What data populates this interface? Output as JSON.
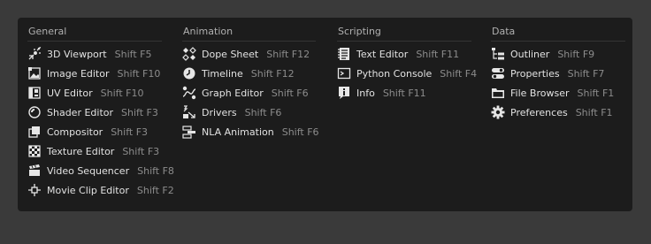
{
  "menu": {
    "columns": [
      {
        "header": "General",
        "items": [
          {
            "label": "3D Viewport",
            "shortcut": "Shift F5",
            "icon": "3d-viewport-icon"
          },
          {
            "label": "Image Editor",
            "shortcut": "Shift F10",
            "icon": "image-editor-icon"
          },
          {
            "label": "UV Editor",
            "shortcut": "Shift F10",
            "icon": "uv-editor-icon"
          },
          {
            "label": "Shader Editor",
            "shortcut": "Shift F3",
            "icon": "shader-editor-icon"
          },
          {
            "label": "Compositor",
            "shortcut": "Shift F3",
            "icon": "compositor-icon"
          },
          {
            "label": "Texture Editor",
            "shortcut": "Shift F3",
            "icon": "texture-editor-icon"
          },
          {
            "label": "Video Sequencer",
            "shortcut": "Shift F8",
            "icon": "video-sequencer-icon"
          },
          {
            "label": "Movie Clip Editor",
            "shortcut": "Shift F2",
            "icon": "movie-clip-editor-icon"
          }
        ]
      },
      {
        "header": "Animation",
        "items": [
          {
            "label": "Dope Sheet",
            "shortcut": "Shift F12",
            "icon": "dope-sheet-icon"
          },
          {
            "label": "Timeline",
            "shortcut": "Shift F12",
            "icon": "timeline-icon"
          },
          {
            "label": "Graph Editor",
            "shortcut": "Shift F6",
            "icon": "graph-editor-icon"
          },
          {
            "label": "Drivers",
            "shortcut": "Shift F6",
            "icon": "drivers-icon"
          },
          {
            "label": "NLA Animation",
            "shortcut": "Shift F6",
            "icon": "nla-icon"
          }
        ]
      },
      {
        "header": "Scripting",
        "items": [
          {
            "label": "Text Editor",
            "shortcut": "Shift F11",
            "icon": "text-editor-icon"
          },
          {
            "label": "Python Console",
            "shortcut": "Shift F4",
            "icon": "python-console-icon"
          },
          {
            "label": "Info",
            "shortcut": "Shift F11",
            "icon": "info-icon"
          }
        ]
      },
      {
        "header": "Data",
        "items": [
          {
            "label": "Outliner",
            "shortcut": "Shift F9",
            "icon": "outliner-icon"
          },
          {
            "label": "Properties",
            "shortcut": "Shift F7",
            "icon": "properties-icon"
          },
          {
            "label": "File Browser",
            "shortcut": "Shift F1",
            "icon": "file-browser-icon"
          },
          {
            "label": "Preferences",
            "shortcut": "Shift F1",
            "icon": "preferences-icon"
          }
        ]
      }
    ]
  },
  "colors": {
    "panel_background": "#1c1c1c",
    "page_background": "#3a3a3a",
    "label_text": "#e2e2e2",
    "shortcut_text": "#8c8c8c",
    "header_text": "#b0b0b0",
    "icon": "#e6e6e6"
  }
}
